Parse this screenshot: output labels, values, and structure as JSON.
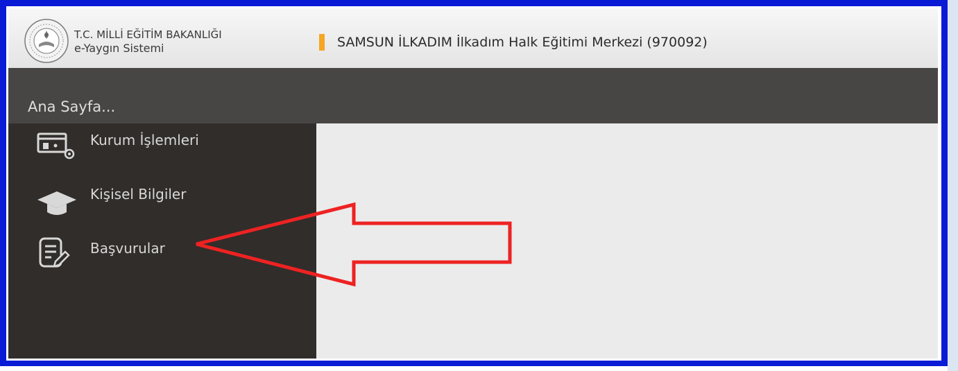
{
  "header": {
    "ministry": "T.C. MİLLİ EĞİTİM BAKANLIĞI",
    "system": "e-Yaygın Sistemi",
    "institution": "SAMSUN İLKADIM İlkadım Halk Eğitimi Merkezi (970092)"
  },
  "sidebar": {
    "title": "Ana Sayfa...",
    "items": [
      {
        "label": "Kurum İşlemleri",
        "icon": "institution-settings-icon"
      },
      {
        "label": "Kişisel Bilgiler",
        "icon": "graduation-cap-icon"
      },
      {
        "label": "Başvurular",
        "icon": "document-edit-icon"
      }
    ]
  },
  "colors": {
    "frame": "#0a1bd6",
    "sidebar": "#312d2a",
    "topbar": "#474644",
    "accent": "#f5a623",
    "annotation": "#ee2222"
  }
}
